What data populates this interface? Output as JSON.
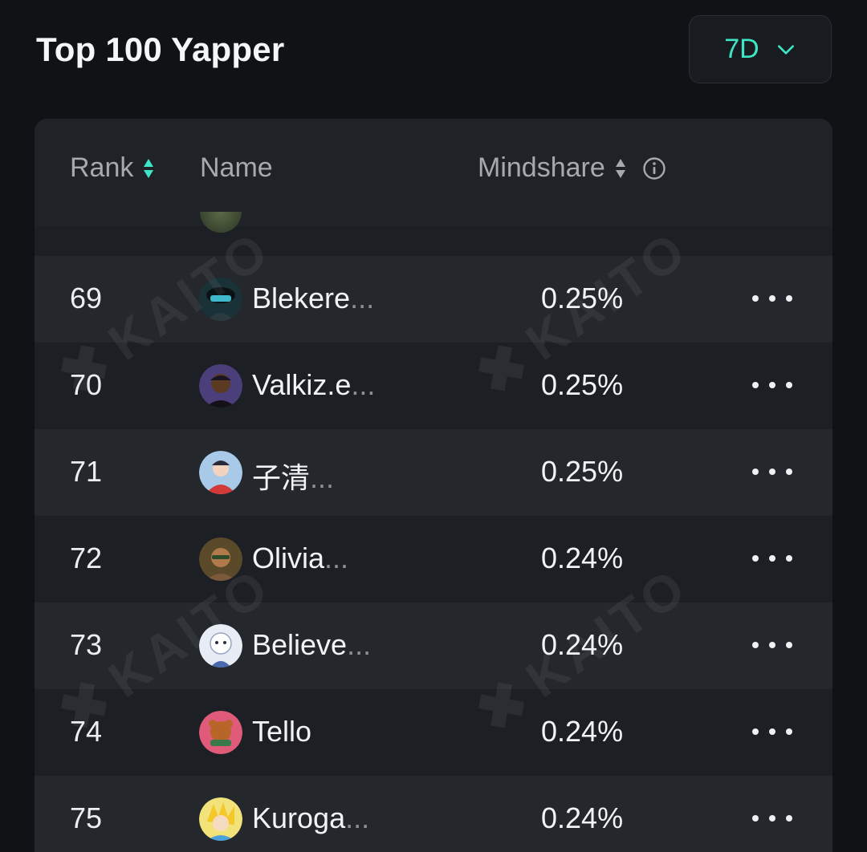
{
  "page": {
    "title": "Top 100 Yapper"
  },
  "period_select": {
    "value": "7D",
    "icon": "chevron-down-icon"
  },
  "table": {
    "columns": {
      "rank": "Rank",
      "name": "Name",
      "mindshare": "Mindshare"
    },
    "rows": [
      {
        "rank": "69",
        "name": "Blekere",
        "truncated": true,
        "mindshare": "0.25%",
        "avatar": "avatar-69"
      },
      {
        "rank": "70",
        "name": "Valkiz.e",
        "truncated": true,
        "mindshare": "0.25%",
        "avatar": "avatar-70"
      },
      {
        "rank": "71",
        "name": "子清",
        "truncated": true,
        "mindshare": "0.25%",
        "avatar": "avatar-71"
      },
      {
        "rank": "72",
        "name": "Olivia",
        "truncated": true,
        "mindshare": "0.24%",
        "avatar": "avatar-72"
      },
      {
        "rank": "73",
        "name": "Believe",
        "truncated": true,
        "mindshare": "0.24%",
        "avatar": "avatar-73"
      },
      {
        "rank": "74",
        "name": "Tello",
        "truncated": false,
        "mindshare": "0.24%",
        "avatar": "avatar-74"
      },
      {
        "rank": "75",
        "name": "Kuroga",
        "truncated": true,
        "mindshare": "0.24%",
        "avatar": "avatar-75"
      }
    ],
    "ellipsis": "..."
  },
  "watermark": {
    "text": "KAITO"
  },
  "colors": {
    "accent": "#3ee6c6",
    "background": "#111216",
    "card": "#1c1f24",
    "row_alt": "#24272c"
  }
}
